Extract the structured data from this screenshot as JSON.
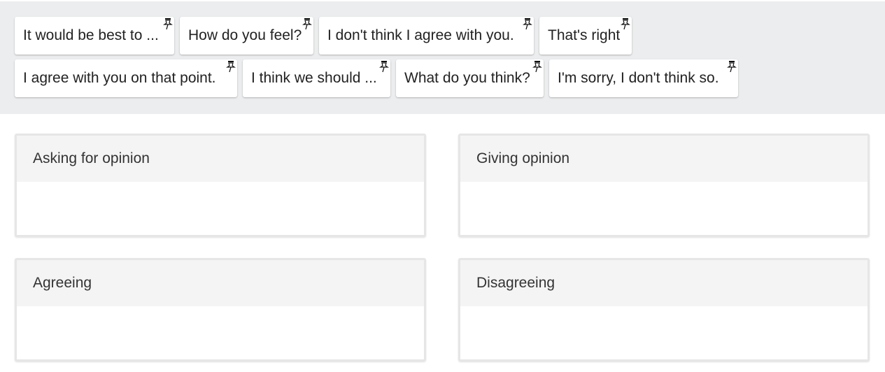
{
  "chips_row_1": [
    {
      "label": "It would be best to ...",
      "icon": "hint-pin-icon"
    },
    {
      "label": "How do you feel?",
      "icon": "hint-pin-icon"
    },
    {
      "label": "I don't think I agree with you.",
      "icon": "hint-pin-icon"
    },
    {
      "label": "That's right",
      "icon": "hint-pin-icon"
    }
  ],
  "chips_row_2": [
    {
      "label": "I agree with you on that point.",
      "icon": "hint-pin-icon"
    },
    {
      "label": "I think we should ...",
      "icon": "hint-pin-icon"
    },
    {
      "label": "What do you think?",
      "icon": "hint-pin-icon"
    },
    {
      "label": "I'm sorry, I don't think so.",
      "icon": "hint-pin-icon"
    }
  ],
  "categories": [
    {
      "title": "Asking for opinion"
    },
    {
      "title": "Giving opinion"
    },
    {
      "title": "Agreeing"
    },
    {
      "title": "Disagreeing"
    }
  ],
  "colors": {
    "pool_background": "#ebedee",
    "chip_background": "#ffffff",
    "category_header": "#f4f4f4",
    "category_border": "#e6e6e6"
  }
}
